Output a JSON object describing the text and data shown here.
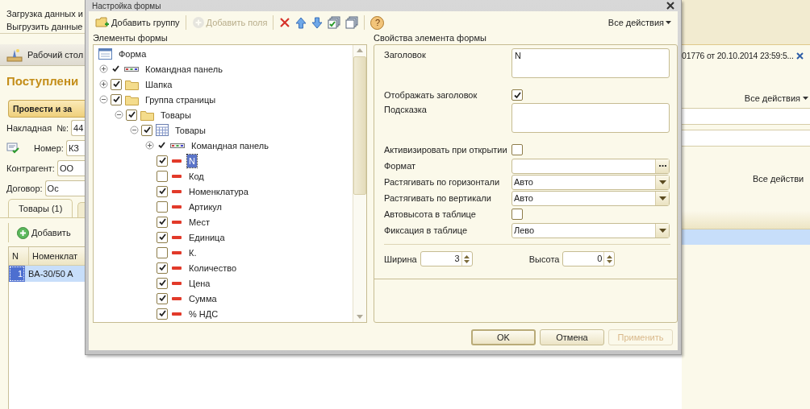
{
  "background": {
    "menu_items": [
      "Загрузка данных и",
      "Выгрузить данные"
    ],
    "desktop_button": "Рабочий стол",
    "document_tab": "01776 от 20.10.2014 23:59:5...",
    "title": "Поступлени",
    "post_button": "Провести и за",
    "all_actions": "Все действия",
    "fields": [
      {
        "label": "Накладная  №:",
        "value": "44"
      },
      {
        "label": "Номер:",
        "value": "КЗ"
      },
      {
        "label": "Контрагент:",
        "value": "ОО"
      },
      {
        "label": "Договор:",
        "value": "Ос"
      }
    ],
    "tabs": [
      {
        "label": "Товары (1)",
        "selected": true
      }
    ],
    "add_button": "Добавить",
    "table_actions": "Все действи",
    "table": {
      "columns": [
        "N",
        "Номенклат"
      ],
      "rows": [
        {
          "cells": [
            "1",
            "BA-30/50 A"
          ],
          "selected": true
        }
      ]
    }
  },
  "dialog": {
    "title": "Настройка формы",
    "toolbar": [
      {
        "kind": "add-group",
        "label": "Добавить группу",
        "disabled": false
      },
      {
        "kind": "add-fields",
        "label": "Добавить поля",
        "disabled": true
      },
      {
        "kind": "delete",
        "disabled": false
      },
      {
        "kind": "move-up",
        "disabled": false
      },
      {
        "kind": "move-down",
        "disabled": false
      },
      {
        "kind": "check-all",
        "disabled": false
      },
      {
        "kind": "uncheck-all",
        "disabled": false
      },
      {
        "kind": "help",
        "label": "?",
        "disabled": false
      }
    ],
    "all_actions": "Все действия",
    "tree_title": "Элементы формы",
    "tree": {
      "kind": "form",
      "label": "Форма",
      "selected": false,
      "children": [
        {
          "kind": "command-panel",
          "label": "Командная панель",
          "checked": true,
          "expanded": false,
          "selected": false
        },
        {
          "kind": "group",
          "label": "Шапка",
          "checked": true,
          "expanded": false,
          "selected": false
        },
        {
          "kind": "group",
          "label": "Группа страницы",
          "checked": true,
          "expanded": true,
          "selected": false,
          "children": [
            {
              "kind": "group",
              "label": "Товары",
              "checked": true,
              "expanded": true,
              "selected": false,
              "children": [
                {
                  "kind": "table",
                  "label": "Товары",
                  "checked": true,
                  "expanded": true,
                  "selected": false,
                  "children": [
                    {
                      "kind": "command-panel",
                      "label": "Командная панель",
                      "checked": true,
                      "expanded": false,
                      "selected": false
                    },
                    {
                      "kind": "field",
                      "label": "N",
                      "checked": true,
                      "selected": true
                    },
                    {
                      "kind": "field",
                      "label": "Код",
                      "checked": false,
                      "selected": false
                    },
                    {
                      "kind": "field",
                      "label": "Номенклатура",
                      "checked": true,
                      "selected": false
                    },
                    {
                      "kind": "field",
                      "label": "Артикул",
                      "checked": false,
                      "selected": false
                    },
                    {
                      "kind": "field",
                      "label": "Мест",
                      "checked": true,
                      "selected": false
                    },
                    {
                      "kind": "field",
                      "label": "Единица",
                      "checked": true,
                      "selected": false
                    },
                    {
                      "kind": "field",
                      "label": "К.",
                      "checked": false,
                      "selected": false
                    },
                    {
                      "kind": "field",
                      "label": "Количество",
                      "checked": true,
                      "selected": false
                    },
                    {
                      "kind": "field",
                      "label": "Цена",
                      "checked": true,
                      "selected": false
                    },
                    {
                      "kind": "field",
                      "label": "Сумма",
                      "checked": true,
                      "selected": false
                    },
                    {
                      "kind": "field",
                      "label": "% НДС",
                      "checked": true,
                      "selected": false
                    }
                  ]
                }
              ]
            }
          ]
        }
      ]
    },
    "properties_title": "Свойства элемента формы",
    "properties": [
      {
        "kind": "text-area",
        "label": "Заголовок",
        "value": "N"
      },
      {
        "kind": "checkbox",
        "label": "Отображать заголовок",
        "checked": true
      },
      {
        "kind": "text-area",
        "label": "Подсказка"
      },
      {
        "kind": "checkbox",
        "label": "Активизировать при открытии",
        "checked": false
      },
      {
        "kind": "choice-field",
        "label": "Формат"
      },
      {
        "kind": "dropdown",
        "label": "Растягивать по горизонтали",
        "value": "Авто"
      },
      {
        "kind": "dropdown",
        "label": "Растягивать по вертикали",
        "value": "Авто"
      },
      {
        "kind": "checkbox",
        "label": "Автовысота в таблице",
        "checked": false
      },
      {
        "kind": "dropdown",
        "label": "Фиксация в таблице",
        "value": "Лево"
      }
    ],
    "sizes": [
      {
        "label": "Ширина",
        "value": "3"
      },
      {
        "label": "Высота",
        "value": "0"
      }
    ],
    "buttons": [
      {
        "label": "OK",
        "default": true,
        "disabled": false
      },
      {
        "label": "Отмена",
        "default": false,
        "disabled": false
      },
      {
        "label": "Применить",
        "default": false,
        "disabled": true
      }
    ]
  }
}
